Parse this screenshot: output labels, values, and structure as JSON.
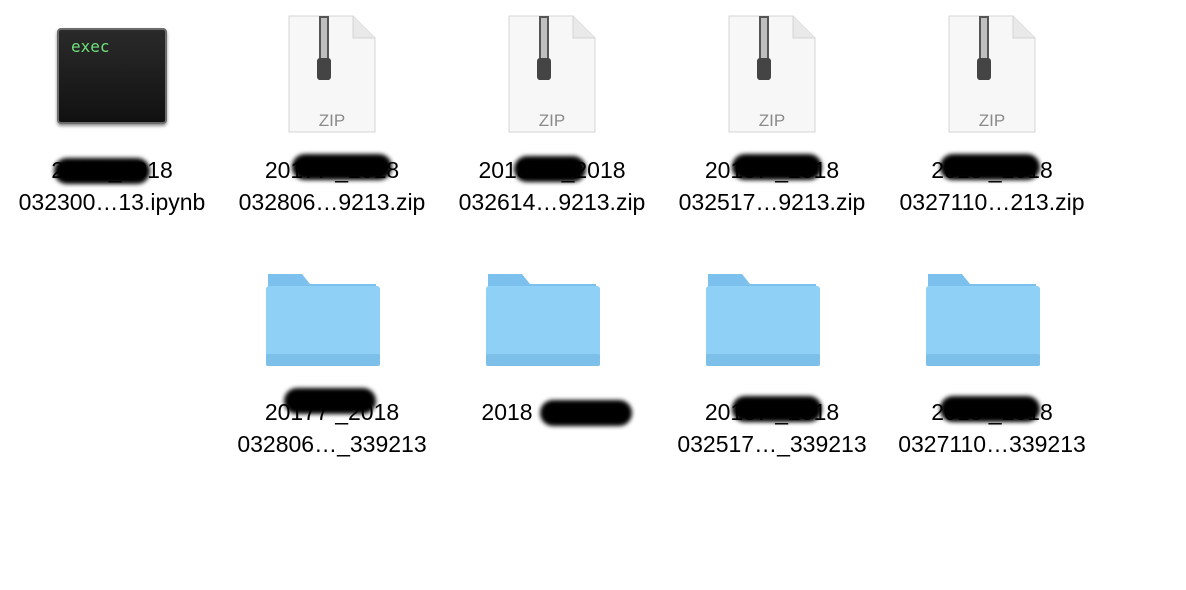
{
  "files": [
    {
      "type": "exec",
      "icon_text": "exec",
      "line1": "2015       _2018",
      "line2": "032300…13.ipynb"
    },
    {
      "type": "zip",
      "icon_text": "ZIP",
      "line1": "20177          _2018",
      "line2": "032806…9213.zip"
    },
    {
      "type": "zip",
      "icon_text": "ZIP",
      "line1": "20187         7_2018",
      "line2": "032614…9213.zip"
    },
    {
      "type": "zip",
      "icon_text": "ZIP",
      "line1": "20187         _2018",
      "line2": "032517…9213.zip"
    },
    {
      "type": "zip",
      "icon_text": "ZIP",
      "line1": "2018          _2018",
      "line2": "0327110…213.zip"
    }
  ],
  "folders": [
    {
      "line1": "20177          _2018",
      "line2": "032806…_339213"
    },
    {
      "line1": "2018",
      "line2": ""
    },
    {
      "line1": "20187         _2018",
      "line2": "032517…_339213"
    },
    {
      "line1": "2018          _2018",
      "line2": "0327110…339213"
    }
  ]
}
